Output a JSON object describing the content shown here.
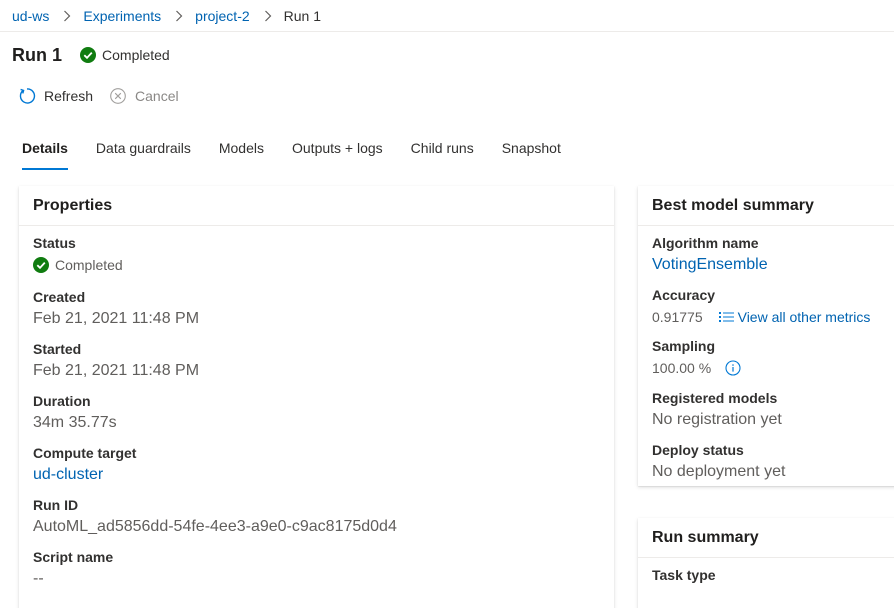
{
  "breadcrumb": {
    "items": [
      "ud-ws",
      "Experiments",
      "project-2",
      "Run 1"
    ]
  },
  "header": {
    "title": "Run 1",
    "status": "Completed"
  },
  "toolbar": {
    "refresh_label": "Refresh",
    "cancel_label": "Cancel"
  },
  "tabs": [
    {
      "label": "Details",
      "active": true
    },
    {
      "label": "Data guardrails"
    },
    {
      "label": "Models"
    },
    {
      "label": "Outputs + logs"
    },
    {
      "label": "Child runs"
    },
    {
      "label": "Snapshot"
    }
  ],
  "properties": {
    "heading": "Properties",
    "status_label": "Status",
    "status_value": "Completed",
    "created_label": "Created",
    "created_value": "Feb 21, 2021 11:48 PM",
    "started_label": "Started",
    "started_value": "Feb 21, 2021 11:48 PM",
    "duration_label": "Duration",
    "duration_value": "34m 35.77s",
    "compute_label": "Compute target",
    "compute_value": "ud-cluster",
    "runid_label": "Run ID",
    "runid_value": "AutoML_ad5856dd-54fe-4ee3-a9e0-c9ac8175d0d4",
    "script_label": "Script name",
    "script_value": "--"
  },
  "best_model": {
    "heading": "Best model summary",
    "algorithm_label": "Algorithm name",
    "algorithm_value": "VotingEnsemble",
    "accuracy_label": "Accuracy",
    "accuracy_value": "0.91775",
    "metrics_link": "View all other metrics",
    "sampling_label": "Sampling",
    "sampling_value": "100.00 %",
    "registered_label": "Registered models",
    "registered_value": "No registration yet",
    "deploy_label": "Deploy status",
    "deploy_value": "No deployment yet"
  },
  "run_summary": {
    "heading": "Run summary",
    "task_label": "Task type"
  },
  "colors": {
    "link": "#0063b1",
    "accent": "#0078d4",
    "success": "#107c10",
    "muted": "#8a8886"
  }
}
